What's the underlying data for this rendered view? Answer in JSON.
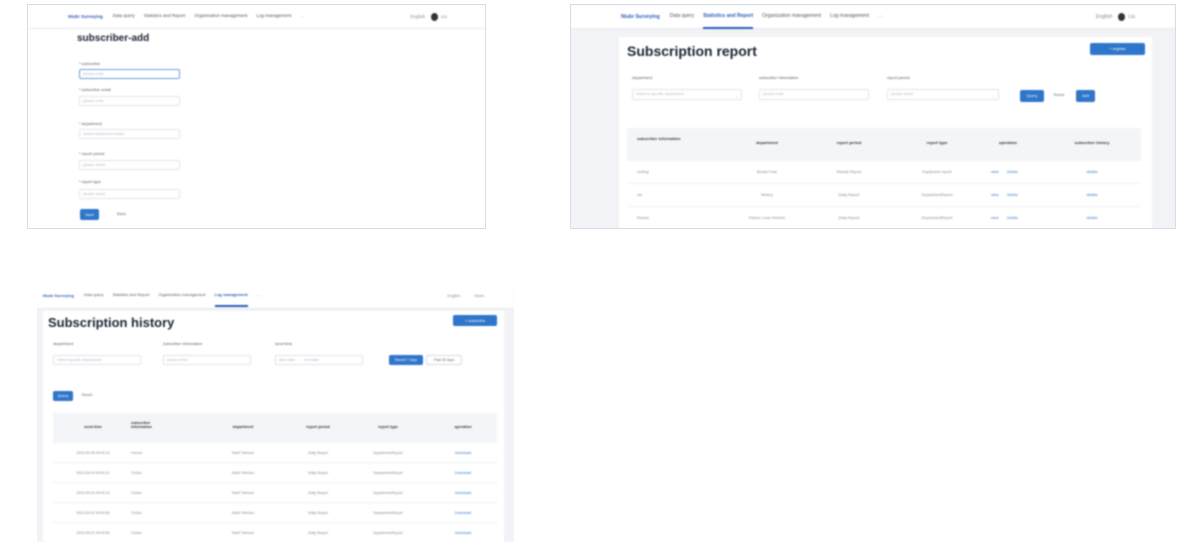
{
  "panel_add": {
    "nav": {
      "brand": "Niubr Surveying",
      "items": [
        "Data query",
        "Statistics and Report",
        "Organization management",
        "Log management"
      ],
      "more": "···",
      "lang": "English",
      "user": "Liu"
    },
    "title": "subscriber-add",
    "form": {
      "fields": [
        {
          "label": "* subscriber",
          "placeholder": "please enter"
        },
        {
          "label": "* subscriber email",
          "placeholder": "please enter"
        },
        {
          "label": "* department",
          "placeholder": "Select department folder"
        },
        {
          "label": "* report period",
          "placeholder": "please select"
        },
        {
          "label": "* report type",
          "placeholder": "please select"
        }
      ],
      "submit": "Save",
      "cancel": "Back"
    }
  },
  "panel_report": {
    "nav": {
      "brand": "Niubr Surveying",
      "items": [
        "Data query",
        "Statistics and Report",
        "Organization management",
        "Log management"
      ],
      "active_index": 1,
      "more": "···",
      "lang": "English",
      "user": "Liu"
    },
    "title": "Subscription report",
    "add_button": "+ register",
    "filters": {
      "department_label": "department",
      "department_placeholder": "Select a specific department",
      "subscriber_label": "subscriber information",
      "subscriber_placeholder": "please enter",
      "period_label": "report period",
      "period_placeholder": "please select",
      "query_button": "Query",
      "reset_button": "Reset",
      "add_button": "Add"
    },
    "table": {
      "headers": [
        "subscriber information",
        "department",
        "report period",
        "report type",
        "operation",
        "subscriber history"
      ],
      "rows": [
        {
          "subscriber": "renting",
          "department": "Bonita Foss",
          "period": "Weekly Report",
          "type": "Equipment report",
          "ops": [
            "view",
            "Delete"
          ],
          "history": "details"
        },
        {
          "subscriber": "xia",
          "department": "Mickey",
          "period": "Daily Report",
          "type": "DepartmentReport",
          "ops": [
            "view",
            "Delete"
          ],
          "history": "details"
        },
        {
          "subscriber": "Rauser",
          "department": "Parkes Louis Fletcher",
          "period": "Daily Report",
          "type": "DepartmentReport",
          "ops": [
            "view",
            "Delete"
          ],
          "history": "details"
        }
      ]
    }
  },
  "panel_history": {
    "nav": {
      "brand": "Niubr Surveying",
      "items": [
        "Data query",
        "Statistics and Report",
        "Organization management",
        "Log management"
      ],
      "active_index": 3,
      "more": "···",
      "lang": "English",
      "user": "Niubr"
    },
    "title": "Subscription history",
    "add_button": "+ subscribe",
    "filters": {
      "department_label": "department",
      "department_placeholder": "Select specific department",
      "subscriber_label": "subscriber information",
      "subscriber_placeholder": "please enter",
      "date_label": "send time",
      "date_start": "start date",
      "date_end": "end date",
      "btn_a": "Recent 7 days",
      "btn_b": "Past 30 days",
      "query_button": "Query",
      "reset_button": "Reset"
    },
    "table": {
      "headers": [
        "send time",
        "subscriber information",
        "department",
        "report period",
        "report type",
        "operation"
      ],
      "rows": [
        {
          "time": "2023-05-05 09:00:15",
          "subscriber": "Fanner",
          "department": "Habit Tiletown",
          "period": "Daily Report",
          "type": "DepartmentReport",
          "op": "Download"
        },
        {
          "time": "2023-05-04 09:00:12",
          "subscriber": "Tucker",
          "department": "Habit Tiletown",
          "period": "Daily Report",
          "type": "DepartmentReport",
          "op": "Download"
        },
        {
          "time": "2023-05-03 09:00:10",
          "subscriber": "Tucker",
          "department": "Habit Tiletown",
          "period": "Daily Report",
          "type": "DepartmentReport",
          "op": "Download"
        },
        {
          "time": "2023-05-02 09:00:08",
          "subscriber": "Tucker",
          "department": "Habit Tiletown",
          "period": "Daily Report",
          "type": "DepartmentReport",
          "op": "Download"
        },
        {
          "time": "2023-05-01 09:00:06",
          "subscriber": "Tucker",
          "department": "Habit Tiletown",
          "period": "Daily Report",
          "type": "DepartmentReport",
          "op": "Download"
        }
      ]
    }
  }
}
